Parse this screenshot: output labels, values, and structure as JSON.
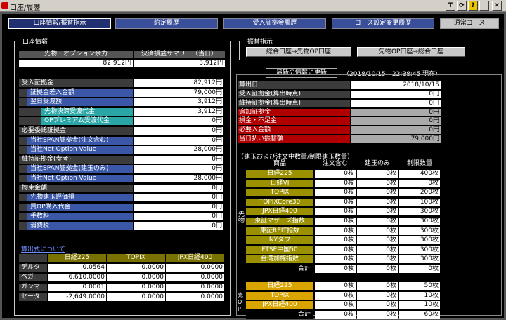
{
  "window": {
    "title": "口座/履歴"
  },
  "tabs": [
    "口座情報/振替指示",
    "約定履歴",
    "受入証拠金履歴",
    "コース設定変更履歴"
  ],
  "course_label": "通常コース",
  "account_info": {
    "group_title": "口座情報",
    "summary_headers": [
      "先物・オプション余力",
      "決済損益サマリー（当日）"
    ],
    "summary_values": [
      "82,912円",
      "3,912円"
    ],
    "rows": [
      {
        "label": "受入証拠金",
        "value": "82,912円"
      },
      {
        "label": "証拠金差入金額",
        "value": "79,000円"
      },
      {
        "label": "翌日受渡額",
        "value": "3,912円"
      },
      {
        "label": "先物決済受渡代金",
        "value": "3,912円"
      },
      {
        "label": "OPプレミアム受渡代金",
        "value": "0円"
      },
      {
        "label": "必要委託証拠金",
        "value": "0円"
      },
      {
        "label": "当社SPAN証拠金(注文含む)",
        "value": "0円"
      },
      {
        "label": "当社Net Option Value",
        "value": "28,000円"
      },
      {
        "label": "維持証拠金(参考)",
        "value": "0円"
      },
      {
        "label": "当社SPAN証拠金(建玉のみ)",
        "value": "0円"
      },
      {
        "label": "当社Net Option Value",
        "value": "28,000円"
      },
      {
        "label": "拘束金額",
        "value": "0円"
      },
      {
        "label": "先物建玉評価損",
        "value": "0円"
      },
      {
        "label": "買OP購入代金",
        "value": "0円"
      },
      {
        "label": "手数料",
        "value": "0円"
      },
      {
        "label": "消費税",
        "value": "0円"
      }
    ],
    "calc_link": "算出式について",
    "greeks": {
      "headers": [
        "日経225",
        "TOPIX",
        "JPX日経400"
      ],
      "rows": [
        {
          "label": "デルタ",
          "values": [
            "0.0564",
            "0.0000",
            "0.0000"
          ]
        },
        {
          "label": "ベガ",
          "values": [
            "6,610.0000",
            "0.0000",
            "0.0000"
          ]
        },
        {
          "label": "ガンマ",
          "values": [
            "0.0001",
            "0.0000",
            "0.0000"
          ]
        },
        {
          "label": "セータ",
          "values": [
            "-2,649.0000",
            "0.0000",
            "0.0000"
          ]
        }
      ]
    }
  },
  "transfer": {
    "group_title": "振替指示",
    "buttons": [
      "総合口座⇒先物OP口座",
      "先物OP口座⇒総合口座"
    ]
  },
  "refresh": {
    "button": "最新の情報に更新",
    "timestamp": "（2018/10/15　22:38:45 現在）"
  },
  "calc_date": {
    "label": "算出日",
    "value": "2018/10/15"
  },
  "status_rows": [
    {
      "label": "受入証拠金(算出時点)",
      "value": "0円",
      "kind": "normal"
    },
    {
      "label": "維持証拠金(算出時点)",
      "value": "0円",
      "kind": "normal"
    },
    {
      "label": "追加証拠金",
      "value": "0円",
      "kind": "red"
    },
    {
      "label": "損金・不足金",
      "value": "0円",
      "kind": "red"
    },
    {
      "label": "必要入金額",
      "value": "0円",
      "kind": "red"
    },
    {
      "label": "当日払い振替額",
      "value": "79,000円",
      "kind": "red"
    }
  ],
  "positions": {
    "title": "【建玉および注文中数量/制限建玉数量】",
    "headers": [
      "商品",
      "注文含む",
      "建玉のみ",
      "制限数量"
    ],
    "futures_label": "先物",
    "futures": [
      {
        "name": "日経225",
        "vals": [
          "0枚",
          "0枚",
          "400枚"
        ]
      },
      {
        "name": "日経VI",
        "vals": [
          "0枚",
          "0枚",
          "0枚"
        ]
      },
      {
        "name": "TOPIX",
        "vals": [
          "0枚",
          "0枚",
          "200枚"
        ]
      },
      {
        "name": "TOPIXCore30",
        "vals": [
          "0枚",
          "0枚",
          "100枚"
        ]
      },
      {
        "name": "JPX日経400",
        "vals": [
          "0枚",
          "0枚",
          "300枚"
        ]
      },
      {
        "name": "東証マザーズ指数",
        "vals": [
          "0枚",
          "0枚",
          "300枚"
        ]
      },
      {
        "name": "東証REIT指数",
        "vals": [
          "0枚",
          "0枚",
          "300枚"
        ]
      },
      {
        "name": "NYダウ",
        "vals": [
          "0枚",
          "0枚",
          "300枚"
        ]
      },
      {
        "name": "FTSE中国50",
        "vals": [
          "0枚",
          "0枚",
          "300枚"
        ]
      },
      {
        "name": "台湾加権指数",
        "vals": [
          "0枚",
          "0枚",
          "300枚"
        ]
      },
      {
        "name": "合計",
        "vals": [
          "0枚",
          "0枚",
          "0枚"
        ]
      }
    ],
    "options_label": "売OP",
    "options": [
      {
        "name": "日経225",
        "vals": [
          "0枚",
          "0枚",
          "50枚"
        ]
      },
      {
        "name": "TOPIX",
        "vals": [
          "0枚",
          "0枚",
          "10枚"
        ]
      },
      {
        "name": "JPX日経400",
        "vals": [
          "0枚",
          "0枚",
          "10枚"
        ]
      },
      {
        "name": "合計",
        "vals": [
          "0枚",
          "0枚",
          "60枚"
        ]
      }
    ]
  }
}
